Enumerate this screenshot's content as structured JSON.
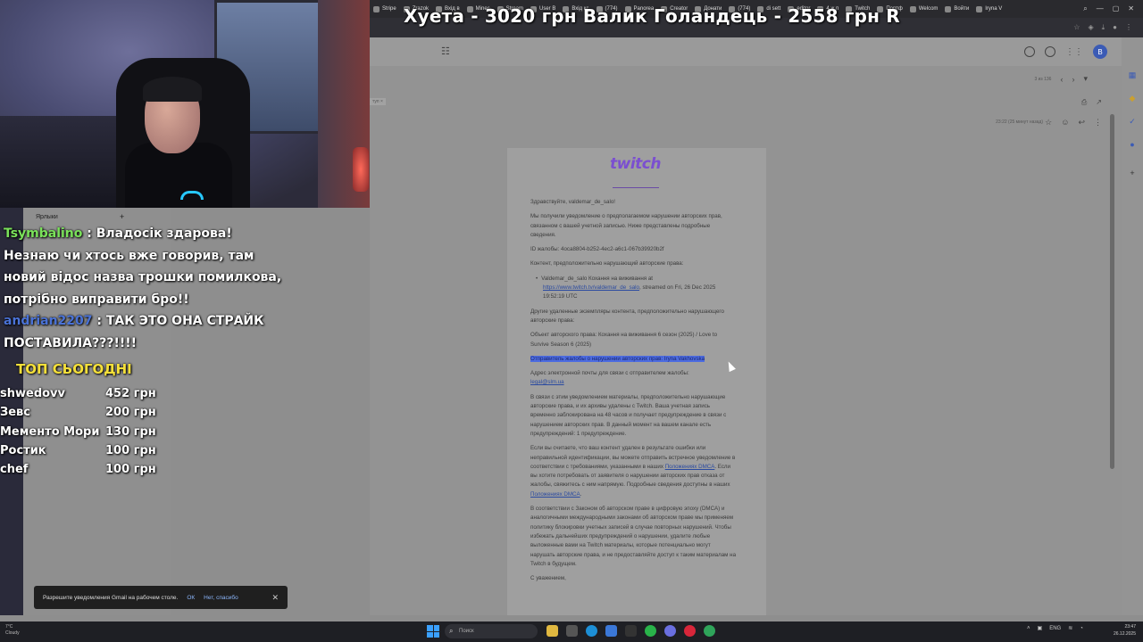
{
  "browser": {
    "tabs": [
      {
        "label": "Stripe"
      },
      {
        "label": "Zrazok"
      },
      {
        "label": "Вхід в"
      },
      {
        "label": "Minec"
      },
      {
        "label": "Stream"
      },
      {
        "label": "User B"
      },
      {
        "label": "Вхід кс"
      },
      {
        "label": "(774)"
      },
      {
        "label": "Panorea"
      },
      {
        "label": "Creator"
      },
      {
        "label": "Донати"
      },
      {
        "label": "(774)"
      },
      {
        "label": "di sett"
      },
      {
        "label": "editor"
      },
      {
        "label": "4 ж п"
      },
      {
        "label": "Twitch"
      },
      {
        "label": "Портф"
      },
      {
        "label": "Welcom"
      },
      {
        "label": "Войти"
      },
      {
        "label": "Iryna V"
      }
    ]
  },
  "donation_overlay": "Хуета  -  3020 грн    Валик Голандець  -  2558 грн    R",
  "gmail": {
    "pager": "3 из 136",
    "label_chip": "туп ×",
    "message_time": "23:22 (25 минут назад)",
    "avatar_letter": "B",
    "notification": {
      "text": "Разрешите уведомления Gmail на рабочем столе.",
      "ok": "ОК",
      "no": "Нет, спасибо"
    }
  },
  "email": {
    "logo": "twitch",
    "greeting": "Здравствуйте, valdemar_de_salo!",
    "p1": "Мы получили уведомление о предполагаемом нарушении авторских прав, связанном с вашей учетной записью. Ниже представлены подробные сведения.",
    "id_line": "ID жалобы: 4oca8804-b252-4ec2-a6c1-067b39920b2f",
    "content_intro": "Контент, предположительно нарушающий авторские права:",
    "bullet_prefix": "Valdemar_de_salo Кохання на виживання at",
    "bullet_link": "https://www.twitch.tv/valdemar_de_salo",
    "bullet_suffix": ", streamed on Fri, 26 Dec 2025 19:52:19 UTC",
    "other_removed": "Другие удаленные экземпляры контента, предположительно нарушающего авторские права:",
    "object": "Объект авторского права: Кохання на виживання 6 сезон (2025) / Love to Survive Season 6 (2025)",
    "sender_highlight": "Отправитель жалобы о нарушении авторских прав: Iryna Vakhovska",
    "email_intro": "Адрес электронной почты для связи с отправителем жалобы:",
    "email_link": "legal@slm.ua",
    "p_removed": "В связи с этим уведомлением материалы, предположительно нарушающие авторские права, и их архивы удалены с Twitch. Ваша учетная запись временно заблокирована на 48 часов и получает предупреждение в связи с нарушением авторских прав. В данный момент на вашем канале есть предупреждений: 1 предупреждение.",
    "p_dmca_a": "Если вы считаете, что ваш контент удален в результате ошибки или неправильной идентификации, вы можете отправить встречное уведомление в соответствии с требованиями, указанными в наших ",
    "p_dmca_link1": "Положениях DMCA",
    "p_dmca_b": ". Если вы хотите потребовать от заявителя о нарушении авторских прав отказа от жалобы, свяжитесь с ним напрямую. Подробные сведения доступны в наших ",
    "p_dmca_link2": "Положениях DMCA",
    "p_law": "В соответствии с Законом об авторском праве в цифровую эпоху (DMCA) и аналогичными международными законами об авторском праве мы применяем политику блокировки учетных записей в случае повторных нарушений. Чтобы избежать дальнейших предупреждений о нарушении, удалите любые выложенные вами на Twitch материалы, которые потенциально могут нарушать авторские права, и не предоставляйте доступ к таким материалам на Twitch в будущем.",
    "p_tail": "С уважением,"
  },
  "chat": {
    "header": "Ярлыки",
    "messages": [
      {
        "user": "Tsymbalino",
        "text": " : Владосік здарова! Незнаю чи хтось вже говорив, там новий відос назва трошки помилкова, потрібно виправити бро!!"
      },
      {
        "user": "andrian2207",
        "text": " : ТАК ЭТО ОНА СТРАЙК ПОСТАВИЛА???!!!!"
      }
    ]
  },
  "top": {
    "title": "ТОП СЬОГОДНІ",
    "rows": [
      {
        "name": "shwedovv",
        "amount": "452 грн"
      },
      {
        "name": "Зевс",
        "amount": "200 грн"
      },
      {
        "name": "Мементо Мори",
        "amount": "130 грн"
      },
      {
        "name": "Ростик",
        "amount": "100 грн"
      },
      {
        "name": "chef",
        "amount": "100 грн"
      }
    ]
  },
  "taskbar": {
    "weather_temp": "7°C",
    "weather_desc": "Cloudy",
    "search_placeholder": "Поиск",
    "lang": "ENG",
    "time": "23:47",
    "date": "26.12.2025"
  },
  "colors": {
    "twitch_purple": "#7b4fd0",
    "chat_green": "#7ae25a",
    "chat_blue": "#4a72d6",
    "top_yellow": "#f5e03a",
    "highlight": "#4d6ce0"
  }
}
